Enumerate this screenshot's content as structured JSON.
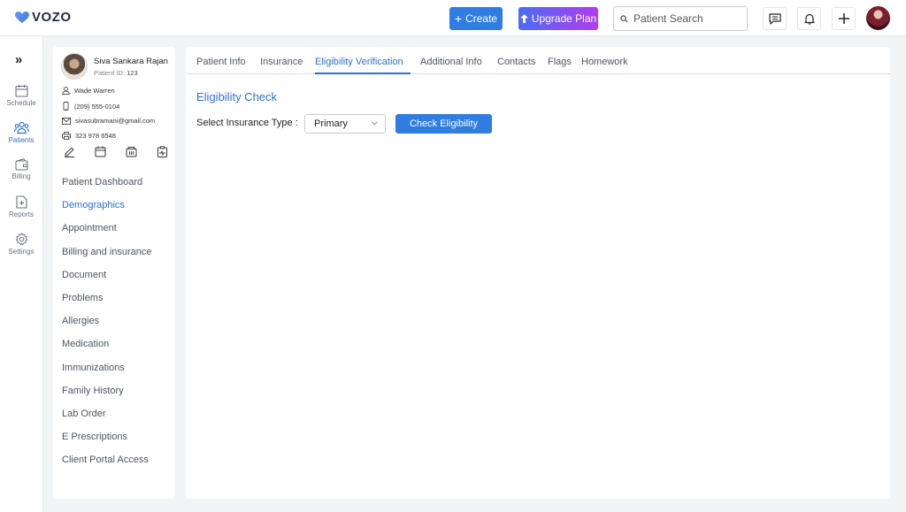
{
  "app": {
    "logo_text": "VOZO"
  },
  "topbar": {
    "create_label": "Create",
    "upgrade_label": "Upgrade Plan",
    "search_placeholder": "Patient Search"
  },
  "rail": {
    "items": [
      {
        "label": "Schedule",
        "icon": "calendar-icon"
      },
      {
        "label": "Patients",
        "icon": "users-icon",
        "active": true
      },
      {
        "label": "Billing",
        "icon": "wallet-icon"
      },
      {
        "label": "Reports",
        "icon": "report-icon"
      },
      {
        "label": "Settings",
        "icon": "gear-icon"
      }
    ]
  },
  "patient": {
    "name": "Siva Sankara Rajan",
    "id_label": "Patient ID:",
    "id_value": "123",
    "contact_name": "Wade Warren",
    "phone": "(209) 555-0104",
    "email": "sivasubramani@gmail.com",
    "fax": "323 978 6548"
  },
  "patient_nav": {
    "items": [
      "Patient Dashboard",
      "Demographics",
      "Appointment",
      "Billing and insurance",
      "Document",
      "Problems",
      "Allergies",
      "Medication",
      "Immunizations",
      "Family History",
      "Lab Order",
      "E Prescriptions",
      "Client Portal Access"
    ],
    "active_index": 1
  },
  "tabs": {
    "items": [
      "Patient Info",
      "Insurance",
      "Eligibility Verification",
      "Additional Info",
      "Contacts",
      "Flags",
      "Homework"
    ],
    "active_index": 2
  },
  "eligibility": {
    "title": "Eligibility Check",
    "insurance_type_label": "Select Insurance Type :",
    "insurance_type_value": "Primary",
    "check_button_label": "Check Eligibility"
  },
  "colors": {
    "accent": "#2f7de1",
    "link": "#2f6fd6",
    "upgrade_start": "#4a6cf7",
    "upgrade_end": "#b13cf0"
  }
}
